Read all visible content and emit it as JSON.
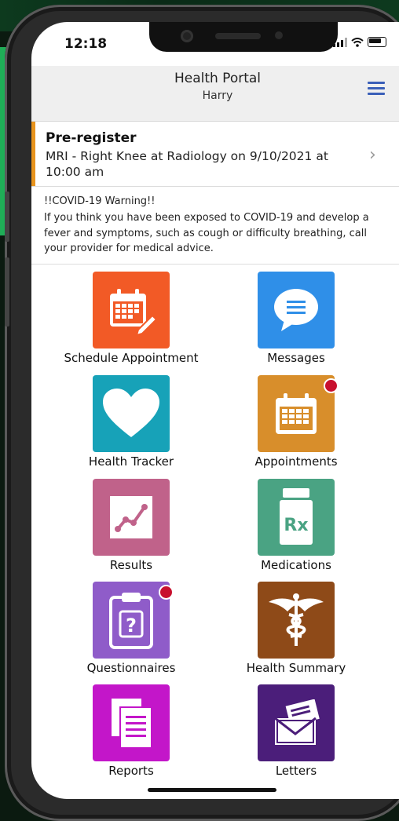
{
  "status_bar": {
    "time": "12:18"
  },
  "header": {
    "title": "Health Portal",
    "subtitle": "Harry"
  },
  "prereg": {
    "title": "Pre-register",
    "description": "MRI - Right Knee at Radiology on 9/10/2021 at 10:00 am"
  },
  "covid": {
    "heading": "!!COVID-19 Warning!!",
    "body": "If you think you have been exposed to COVID-19 and develop a fever and symptoms, such as cough or difficulty breathing, call your provider for medical advice."
  },
  "tiles": [
    {
      "label": "Schedule Appointment",
      "icon": "calendar-edit-icon",
      "color": "#f25a26",
      "badge": false
    },
    {
      "label": "Messages",
      "icon": "chat-bubble-icon",
      "color": "#2f8fe8",
      "badge": false
    },
    {
      "label": "Health Tracker",
      "icon": "heart-icon",
      "color": "#17a2b8",
      "badge": false
    },
    {
      "label": "Appointments",
      "icon": "calendar-icon",
      "color": "#d88e2b",
      "badge": true
    },
    {
      "label": "Results",
      "icon": "line-chart-icon",
      "color": "#c0628a",
      "badge": false
    },
    {
      "label": "Medications",
      "icon": "rx-bottle-icon",
      "color": "#4aa383",
      "badge": false
    },
    {
      "label": "Questionnaires",
      "icon": "clipboard-question-icon",
      "color": "#8f5cc9",
      "badge": true
    },
    {
      "label": "Health Summary",
      "icon": "caduceus-icon",
      "color": "#8e4a18",
      "badge": false
    },
    {
      "label": "Reports",
      "icon": "document-stack-icon",
      "color": "#c316c9",
      "badge": false
    },
    {
      "label": "Letters",
      "icon": "envelope-letter-icon",
      "color": "#4b1e7a",
      "badge": false
    }
  ]
}
